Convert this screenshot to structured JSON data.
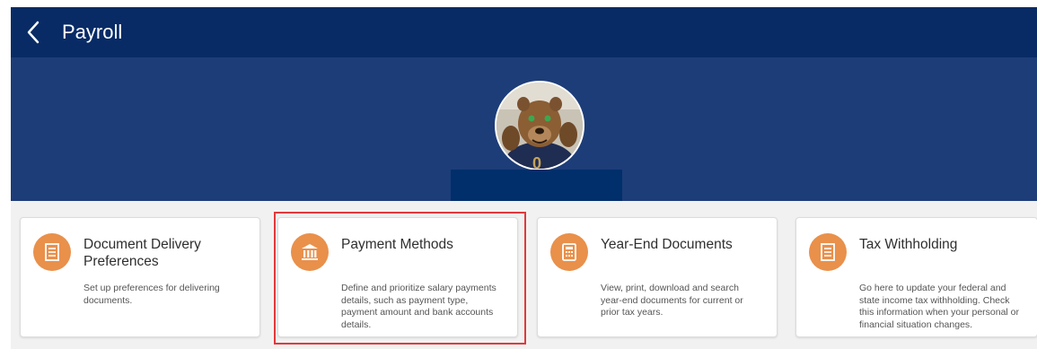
{
  "header": {
    "title": "Payroll",
    "back_icon": "chevron-left-icon",
    "background": "#082b66"
  },
  "banner": {
    "background": "#1d3d78",
    "avatar_icon": "mascot-avatar"
  },
  "cards": [
    {
      "title": "Document Delivery Preferences",
      "description": "Set up preferences for delivering documents.",
      "icon": "document-icon"
    },
    {
      "title": "Payment Methods",
      "description": "Define and prioritize salary payments details, such as payment type, payment amount and bank accounts details.",
      "icon": "bank-icon"
    },
    {
      "title": "Year-End Documents",
      "description": "View, print, download and search year-end documents for current or prior tax years.",
      "icon": "calculator-icon"
    },
    {
      "title": "Tax Withholding",
      "description": "Go here to update your federal and state income tax withholding. Check this information when your personal or financial situation changes.",
      "icon": "document-icon"
    }
  ],
  "colors": {
    "icon_accent": "#e9904b",
    "highlight": "#e1393d"
  }
}
